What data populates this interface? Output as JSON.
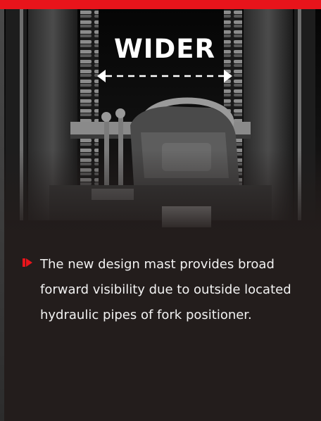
{
  "headline": "WIDER",
  "description": "The new design mast provides broad forward visibility due to outside located hydraulic pipes of fork positioner.",
  "colors": {
    "accent": "#e8141b",
    "background": "#231d1c",
    "text": "#f2f2f2",
    "headline": "#ffffff"
  },
  "icons": {
    "bullet": "red-arrow-bullet-icon",
    "width_arrow": "double-arrow-icon"
  }
}
